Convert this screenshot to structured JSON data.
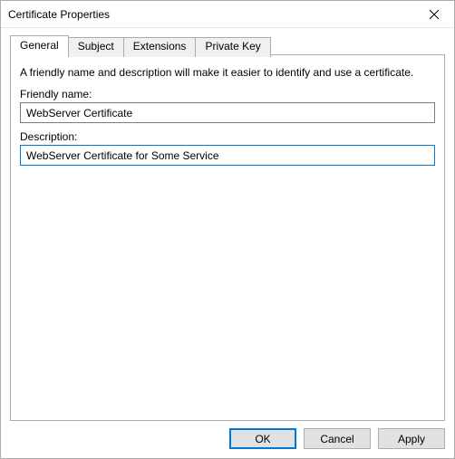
{
  "window": {
    "title": "Certificate Properties"
  },
  "tabs": {
    "general": "General",
    "subject": "Subject",
    "extensions": "Extensions",
    "private_key": "Private Key"
  },
  "general_tab": {
    "help_text": "A friendly name and description will make it easier to identify and use a certificate.",
    "friendly_name_label": "Friendly name:",
    "friendly_name_value": "WebServer Certificate",
    "description_label": "Description:",
    "description_value": "WebServer Certificate for Some Service"
  },
  "buttons": {
    "ok": "OK",
    "cancel": "Cancel",
    "apply": "Apply"
  }
}
